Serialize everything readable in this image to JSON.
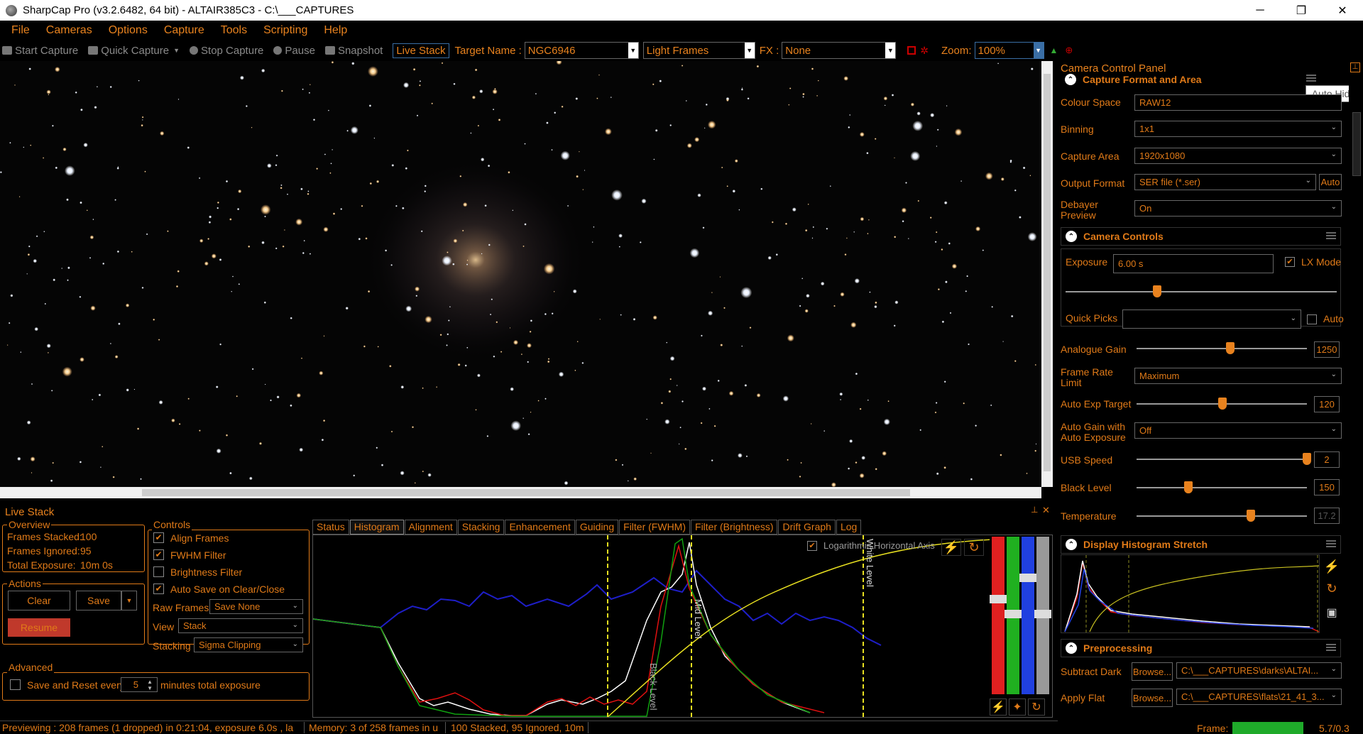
{
  "window": {
    "title": "SharpCap Pro (v3.2.6482, 64 bit) - ALTAIR385C3 - C:\\___CAPTURES",
    "minimize": "─",
    "restore": "❐",
    "close": "✕"
  },
  "menu": [
    "File",
    "Cameras",
    "Options",
    "Capture",
    "Tools",
    "Scripting",
    "Help"
  ],
  "toolbar": {
    "start_capture": "Start Capture",
    "quick_capture": "Quick Capture",
    "stop_capture": "Stop Capture",
    "pause": "Pause",
    "snapshot": "Snapshot",
    "live_stack": "Live Stack",
    "target_label": "Target Name :",
    "target_value": "NGC6946",
    "frame_type": "Light Frames",
    "fx_label": "FX :",
    "fx_value": "None",
    "zoom_label": "Zoom:",
    "zoom_value": "100%"
  },
  "live_stack": {
    "title": "Live Stack",
    "overview": {
      "label": "Overview",
      "frames_stacked": "Frames Stacked:",
      "frames_stacked_val": "100",
      "frames_ignored": "Frames Ignored:",
      "frames_ignored_val": "95",
      "total_exposure": "Total Exposure:",
      "total_exposure_val": "10m 0s"
    },
    "actions": {
      "label": "Actions",
      "clear": "Clear",
      "save": "Save",
      "resume": "Resume"
    },
    "controls": {
      "label": "Controls",
      "align": "Align Frames",
      "fwhm": "FWHM Filter",
      "brightness": "Brightness Filter",
      "autosave": "Auto Save on Clear/Close",
      "raw_frames_label": "Raw Frames",
      "raw_frames": "Save None",
      "view_label": "View",
      "view": "Stack",
      "stacking_label": "Stacking",
      "stacking": "Sigma Clipping"
    },
    "advanced": {
      "label": "Advanced",
      "save_reset": "Save and Reset every",
      "minutes": "5",
      "minutes_label": "minutes total exposure"
    },
    "tabs": [
      "Status",
      "Histogram",
      "Alignment",
      "Stacking",
      "Enhancement",
      "Guiding",
      "Filter (FWHM)",
      "Filter (Brightness)",
      "Drift Graph",
      "Log"
    ],
    "log_axis": "Logarithmic Horizontal Axis",
    "black_level": "Black Level",
    "mid_level": "Mid Level",
    "white_level": "White Level"
  },
  "status": {
    "preview": "Previewing : 208 frames (1 dropped) in 0:21:04, exposure 6.0s , la",
    "memory": "Memory: 3 of 258 frames in u",
    "stacked": "100 Stacked, 95 Ignored, 10m",
    "frame_label": "Frame:",
    "frame_val": "5.7/0.3"
  },
  "camera_panel": {
    "title": "Camera Control Panel",
    "tooltip": "Auto Hide",
    "capture_format": {
      "header": "Capture Format and Area",
      "colour_space": "Colour Space",
      "colour_space_val": "RAW12",
      "binning": "Binning",
      "binning_val": "1x1",
      "capture_area": "Capture Area",
      "capture_area_val": "1920x1080",
      "output_format": "Output Format",
      "output_format_val": "SER file (*.ser)",
      "auto": "Auto",
      "debayer": "Debayer Preview",
      "debayer_val": "On"
    },
    "camera_controls": {
      "header": "Camera Controls",
      "exposure": "Exposure",
      "exposure_val": "6.00 s",
      "lx_mode": "LX Mode",
      "quick_picks": "Quick Picks",
      "auto": "Auto",
      "analogue_gain": "Analogue Gain",
      "analogue_gain_val": "1250",
      "frame_rate": "Frame Rate Limit",
      "frame_rate_val": "Maximum",
      "auto_exp_target": "Auto Exp Target",
      "auto_exp_target_val": "120",
      "auto_gain": "Auto Gain with Auto Exposure",
      "auto_gain_val": "Off",
      "usb_speed": "USB Speed",
      "usb_speed_val": "2",
      "black_level": "Black Level",
      "black_level_val": "150",
      "temperature": "Temperature",
      "temperature_val": "17.2"
    },
    "histogram": {
      "header": "Display Histogram Stretch"
    },
    "preprocessing": {
      "header": "Preprocessing",
      "subtract_dark": "Subtract Dark",
      "browse": "Browse...",
      "dark_path": "C:\\___CAPTURES\\darks\\ALTAI...",
      "apply_flat": "Apply Flat",
      "flat_path": "C:\\___CAPTURES\\flats\\21_41_3..."
    }
  }
}
